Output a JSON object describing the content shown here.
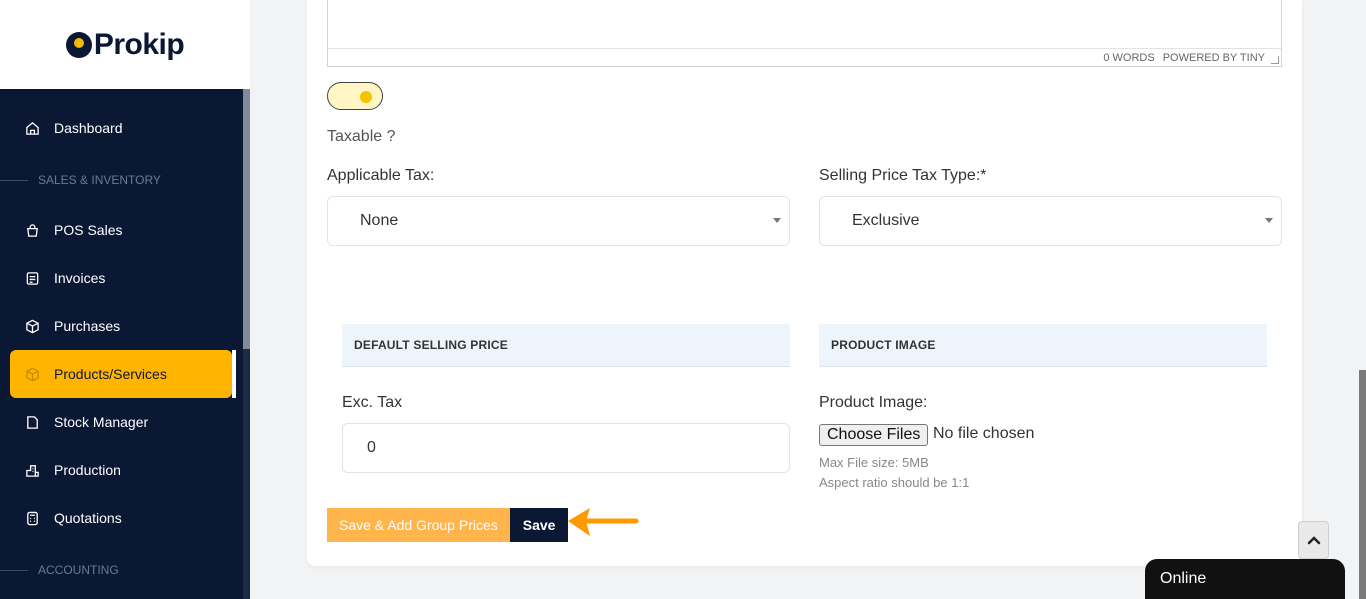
{
  "brand": {
    "name": "Prokip"
  },
  "sidebar": {
    "items": [
      {
        "label": "Dashboard",
        "icon": "home-icon"
      },
      {
        "label": "POS Sales",
        "icon": "shopping-bag-icon"
      },
      {
        "label": "Invoices",
        "icon": "invoice-icon"
      },
      {
        "label": "Purchases",
        "icon": "package-icon"
      },
      {
        "label": "Products/Services",
        "icon": "cube-icon"
      },
      {
        "label": "Stock Manager",
        "icon": "stock-icon"
      },
      {
        "label": "Production",
        "icon": "factory-icon"
      },
      {
        "label": "Quotations",
        "icon": "calculator-icon"
      }
    ],
    "sections": {
      "sales_inventory": "SALES & INVENTORY",
      "accounting": "ACCOUNTING"
    },
    "active_color": "#ffb400"
  },
  "editor": {
    "word_count": "0 WORDS",
    "powered_by": "POWERED BY TINY"
  },
  "form": {
    "taxable_label": "Taxable ?",
    "taxable_on": true,
    "applicable_tax": {
      "label": "Applicable Tax:",
      "value": "None"
    },
    "selling_price_tax_type": {
      "label": "Selling Price Tax Type:*",
      "value": "Exclusive"
    },
    "default_selling_price": {
      "heading": "DEFAULT SELLING PRICE",
      "exc_tax_label": "Exc. Tax",
      "exc_tax_value": "0"
    },
    "product_image": {
      "heading": "PRODUCT IMAGE",
      "label": "Product Image:",
      "button": "Choose Files",
      "status": "No file chosen",
      "max_size": "Max File size: 5MB",
      "aspect": "Aspect ratio should be 1:1"
    }
  },
  "actions": {
    "save_group": "Save & Add Group Prices",
    "save": "Save"
  },
  "chat": {
    "status": "Online"
  },
  "colors": {
    "sidebar_bg": "#0a1833",
    "accent": "#ffb400",
    "save_group_bg": "#ffb44c",
    "arrow": "#ff9900"
  }
}
